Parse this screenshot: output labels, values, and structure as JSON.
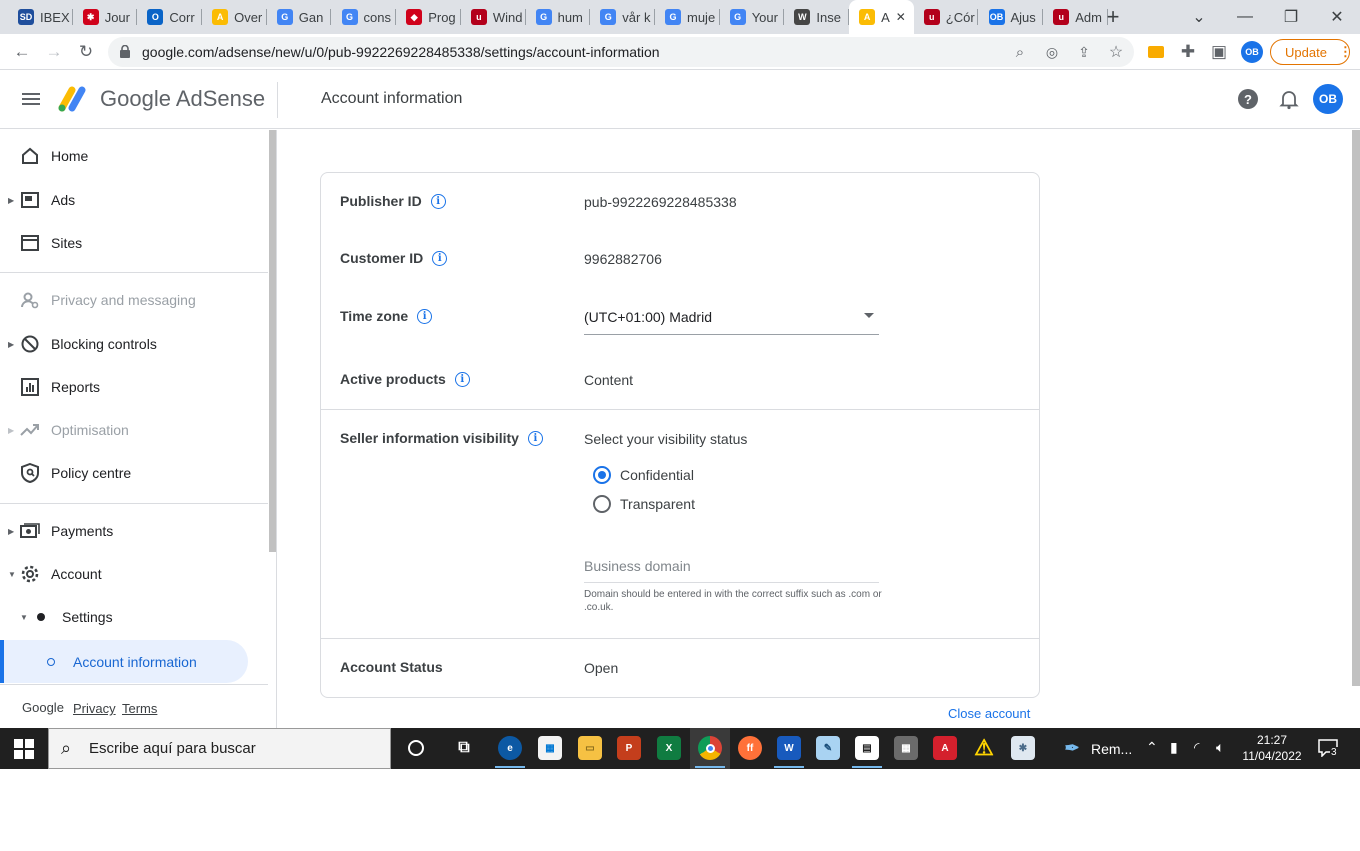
{
  "browser": {
    "tabs": [
      {
        "label": "IBEX",
        "fav": "SD",
        "color": "#1f4e9c"
      },
      {
        "label": "Jour",
        "fav": "✱",
        "color": "#d0021b"
      },
      {
        "label": "Corr",
        "fav": "O",
        "color": "#0a64c7"
      },
      {
        "label": "Over",
        "fav": "A",
        "color": "#fbbc04"
      },
      {
        "label": "Gan",
        "fav": "G",
        "color": "#4285f4"
      },
      {
        "label": "cons",
        "fav": "G",
        "color": "#4285f4"
      },
      {
        "label": "Prog",
        "fav": "◆",
        "color": "#d0021b"
      },
      {
        "label": "Wind",
        "fav": "u",
        "color": "#b3001b"
      },
      {
        "label": "hum",
        "fav": "G",
        "color": "#4285f4"
      },
      {
        "label": "vår k",
        "fav": "G",
        "color": "#4285f4"
      },
      {
        "label": "muje",
        "fav": "G",
        "color": "#4285f4"
      },
      {
        "label": "Your",
        "fav": "G",
        "color": "#4285f4"
      },
      {
        "label": "Inse",
        "fav": "W",
        "color": "#464646"
      },
      {
        "label": "A",
        "fav": "A",
        "color": "#fbbc04"
      },
      {
        "label": "¿Cór",
        "fav": "u",
        "color": "#b3001b"
      },
      {
        "label": "Ajus",
        "fav": "OB",
        "color": "#1a73e8"
      },
      {
        "label": "Adm",
        "fav": "u",
        "color": "#b3001b"
      }
    ],
    "new_tab": "+",
    "url": "google.com/adsense/new/u/0/pub-9922269228485338/settings/account-information",
    "profile_initials": "OB",
    "update_label": "Update"
  },
  "header": {
    "brand": "Google AdSense",
    "page_title": "Account information",
    "avatar": "OB"
  },
  "sidebar": {
    "items": [
      {
        "label": "Home",
        "icon": "home-icon"
      },
      {
        "label": "Ads",
        "icon": "ads-icon"
      },
      {
        "label": "Sites",
        "icon": "sites-icon"
      },
      {
        "label": "Privacy and messaging",
        "icon": "privacy-icon"
      },
      {
        "label": "Blocking controls",
        "icon": "block-icon"
      },
      {
        "label": "Reports",
        "icon": "reports-icon"
      },
      {
        "label": "Optimisation",
        "icon": "optimisation-icon"
      },
      {
        "label": "Policy centre",
        "icon": "policy-icon"
      },
      {
        "label": "Payments",
        "icon": "payments-icon"
      },
      {
        "label": "Account",
        "icon": "gear-icon"
      },
      {
        "label": "Settings",
        "icon": "dot-icon"
      },
      {
        "label": "Account information",
        "icon": "circle-icon"
      }
    ],
    "footer": {
      "google": "Google",
      "privacy": "Privacy",
      "terms": "Terms"
    }
  },
  "account": {
    "publisher_id_label": "Publisher ID",
    "publisher_id": "pub-9922269228485338",
    "customer_id_label": "Customer ID",
    "customer_id": "9962882706",
    "time_zone_label": "Time zone",
    "time_zone": "(UTC+01:00) Madrid",
    "active_products_label": "Active products",
    "active_products": "Content",
    "seller_visibility_label": "Seller information visibility",
    "visibility_prompt": "Select your visibility status",
    "option_confidential": "Confidential",
    "option_transparent": "Transparent",
    "selected_option": "Confidential",
    "business_domain_placeholder": "Business domain",
    "business_domain_hint": "Domain should be entered in with the correct suffix such as .com or .co.uk.",
    "account_status_label": "Account Status",
    "account_status": "Open",
    "close_account": "Close account"
  },
  "taskbar": {
    "search_placeholder": "Escribe aquí para buscar",
    "tray_text": "Rem...",
    "time": "21:27",
    "date": "11/04/2022",
    "notifications": "3"
  }
}
